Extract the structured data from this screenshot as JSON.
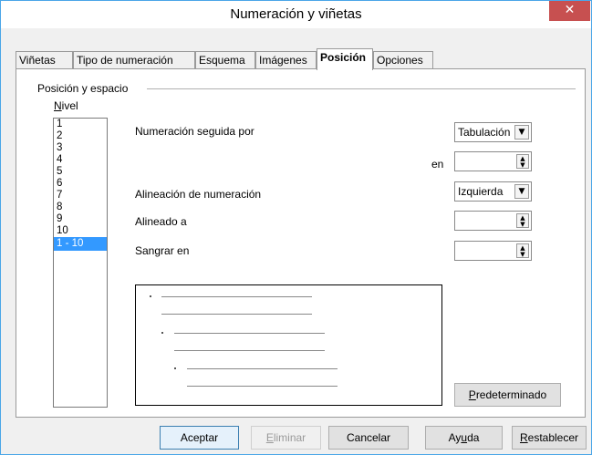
{
  "window": {
    "title": "Numeración y viñetas"
  },
  "tabs": [
    {
      "label": "Viñetas"
    },
    {
      "label": "Tipo de numeración"
    },
    {
      "label": "Esquema"
    },
    {
      "label": "Imágenes"
    },
    {
      "label": "Posición",
      "active": true
    },
    {
      "label": "Opciones"
    }
  ],
  "position": {
    "group_label": "Posición y espacio",
    "level_label": "Nivel",
    "levels": [
      "1",
      "2",
      "3",
      "4",
      "5",
      "6",
      "7",
      "8",
      "9",
      "10",
      "1 - 10"
    ],
    "selected_level": "1 - 10",
    "numbering_followed_by": {
      "label": "Numeración seguida por",
      "value": "Tabulación"
    },
    "at": {
      "label": "en",
      "value": ""
    },
    "numbering_alignment": {
      "label": "Alineación de numeración",
      "value": "Izquierda"
    },
    "aligned_at": {
      "label": "Alineado a",
      "value": ""
    },
    "indent_at": {
      "label": "Sangrar en",
      "value": ""
    },
    "default_button": "Predeterminado"
  },
  "footer": {
    "ok": "Aceptar",
    "delete": "Eliminar",
    "cancel": "Cancelar",
    "help": "Ayuda",
    "reset": "Restablecer"
  },
  "colors": {
    "accent": "#3399ff",
    "close": "#c75050",
    "window_border": "#4aa6e8"
  }
}
